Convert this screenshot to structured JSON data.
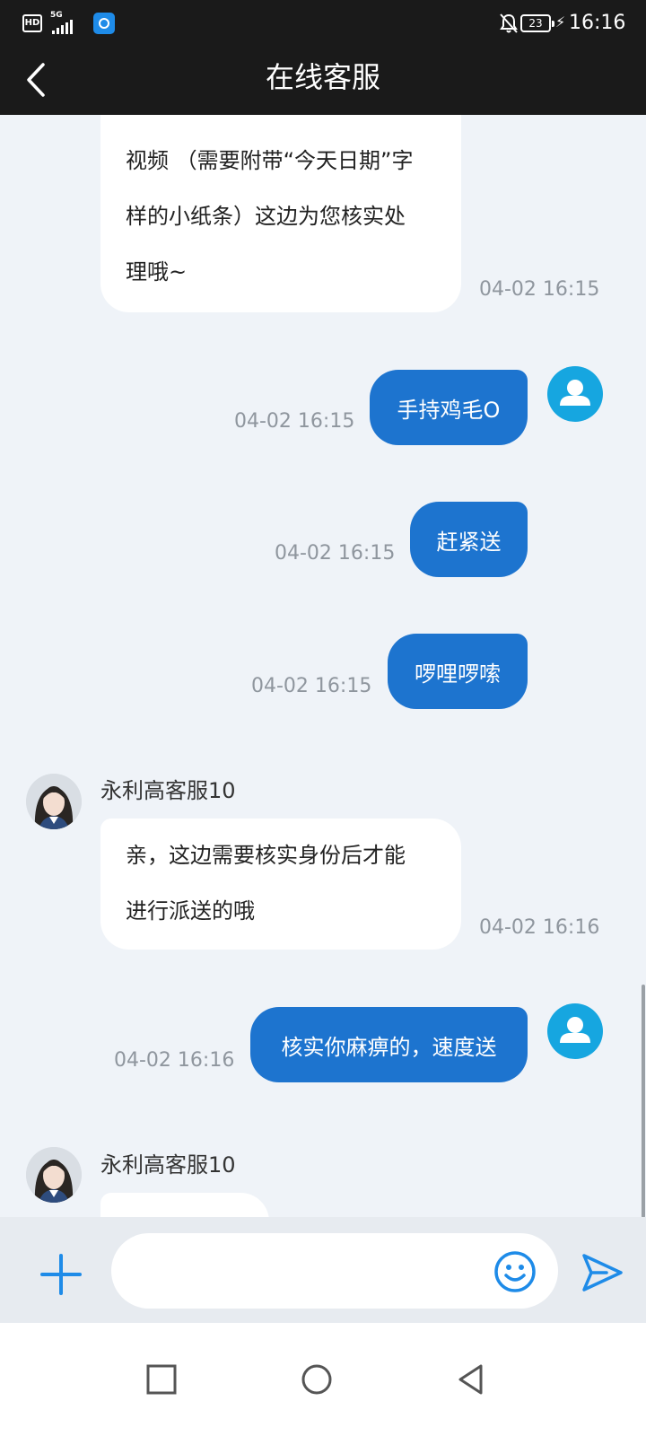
{
  "status_bar": {
    "hd_label": "HD",
    "network_label": "5G",
    "battery_level": "23",
    "time": "16:16"
  },
  "header": {
    "title": "在线客服"
  },
  "messages": [
    {
      "side": "in",
      "text": "视频 （需要附带“今天日期”字样的小纸条）这边为您核实处理哦~",
      "lines": [
        "视频 （需要附带“今天日期”字",
        "样的小纸条）这边为您核实处",
        "理哦~"
      ],
      "time": "04-02 16:15"
    },
    {
      "side": "out",
      "text": "手持鸡毛O",
      "time": "04-02 16:15"
    },
    {
      "side": "out",
      "text": "赶紧送",
      "time": "04-02 16:15"
    },
    {
      "side": "out",
      "text": "啰哩啰嗦",
      "time": "04-02 16:15"
    },
    {
      "side": "in",
      "sender": "永利高客服10",
      "text": "亲，这边需要核实身份后才能进行派送的哦",
      "lines": [
        "亲，这边需要核实身份后才能",
        "进行派送的哦"
      ],
      "time": "04-02 16:16"
    },
    {
      "side": "out",
      "text": "核实你麻痹的，速度送",
      "time": "04-02 16:16"
    },
    {
      "side": "in",
      "sender": "永利高客服10",
      "text": ""
    }
  ],
  "input": {
    "placeholder": "",
    "value": ""
  },
  "icons": {
    "back": "chevron-left-icon",
    "plus": "plus-icon",
    "emoji": "smiley-icon",
    "send": "send-icon",
    "nav_recent": "square-icon",
    "nav_home": "circle-icon",
    "nav_back": "triangle-back-icon"
  },
  "colors": {
    "accent": "#1d74cf",
    "header_bg": "#1a1a1a",
    "chat_bg": "#eff3f8",
    "icon_blue": "#1e8be8"
  }
}
